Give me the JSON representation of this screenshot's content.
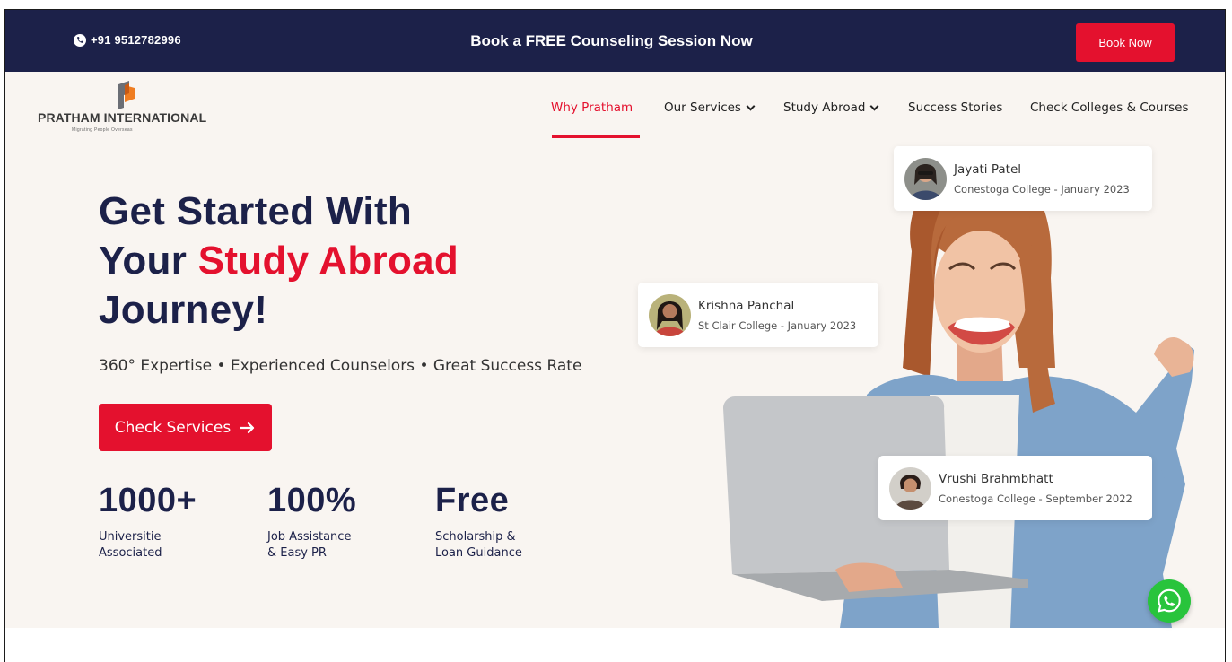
{
  "topbar": {
    "phone": "+91 9512782996",
    "phone_icon": "phone-icon",
    "promo": "Book a FREE Counseling Session Now",
    "book_label": "Book Now"
  },
  "logo": {
    "name": "PRATHAM INTERNATIONAL",
    "tagline": "Migrating People Overseas"
  },
  "nav": {
    "items": [
      {
        "label": "Why Pratham",
        "active": true
      },
      {
        "label": "Our Services",
        "dropdown": true
      },
      {
        "label": "Study Abroad",
        "dropdown": true
      },
      {
        "label": "Success Stories"
      },
      {
        "label": "Check Colleges & Courses"
      }
    ]
  },
  "hero": {
    "line1": "Get Started With",
    "line2_prefix": "Your ",
    "line2_highlight": "Study Abroad",
    "line3": "Journey!",
    "tagline": "360° Expertise • Experienced Counselors • Great Success Rate",
    "cta_label": "Check Services",
    "cta_icon": "arrow-right-icon",
    "stats": [
      {
        "value": "1000+",
        "label": "Universitie\nAssociated"
      },
      {
        "value": "100%",
        "label": "Job Assistance\n& Easy PR"
      },
      {
        "value": "Free",
        "label": "Scholarship &\nLoan Guidance"
      }
    ]
  },
  "reviews": [
    {
      "name": "Jayati Patel",
      "detail": "Conestoga College - January 2023"
    },
    {
      "name": "Krishna Panchal",
      "detail": "St Clair College - January 2023"
    },
    {
      "name": "Vrushi Brahmbhatt",
      "detail": "Conestoga College - September 2022"
    }
  ],
  "colors": {
    "navy": "#1c2149",
    "red": "#e4112e",
    "hero_bg": "#f9f5f1",
    "whatsapp": "#28c43c"
  }
}
